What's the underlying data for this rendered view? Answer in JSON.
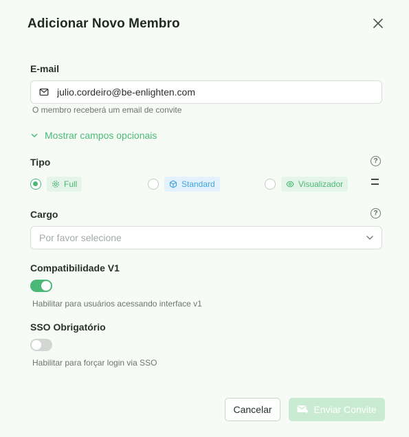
{
  "dialog": {
    "title": "Adicionar Novo Membro"
  },
  "email": {
    "label": "E-mail",
    "value": "julio.cordeiro@be-enlighten.com",
    "hint": "O membro receberá um email de convite"
  },
  "optional": {
    "label": "Mostrar campos opcionais"
  },
  "tipo": {
    "label": "Tipo",
    "help": "?",
    "options": [
      {
        "label": "Full",
        "checked": true,
        "icon": "gear-icon"
      },
      {
        "label": "Standard",
        "checked": false,
        "icon": "cube-icon"
      },
      {
        "label": "Visualizador",
        "checked": false,
        "icon": "eye-icon"
      }
    ]
  },
  "cargo": {
    "label": "Cargo",
    "help": "?",
    "placeholder": "Por favor selecione"
  },
  "compat": {
    "label": "Compatibilidade V1",
    "enabled": true,
    "hint": "Habilitar para usuários acessando interface v1"
  },
  "sso": {
    "label": "SSO Obrigatório",
    "enabled": false,
    "hint": "Habilitar para forçar login via SSO"
  },
  "footer": {
    "cancel_label": "Cancelar",
    "send_label": "Enviar Convite"
  },
  "colors": {
    "accent": "#4bb876",
    "standard": "#3fa6dc",
    "background": "#f6fbf6",
    "send_disabled": "#c8ebd2"
  }
}
